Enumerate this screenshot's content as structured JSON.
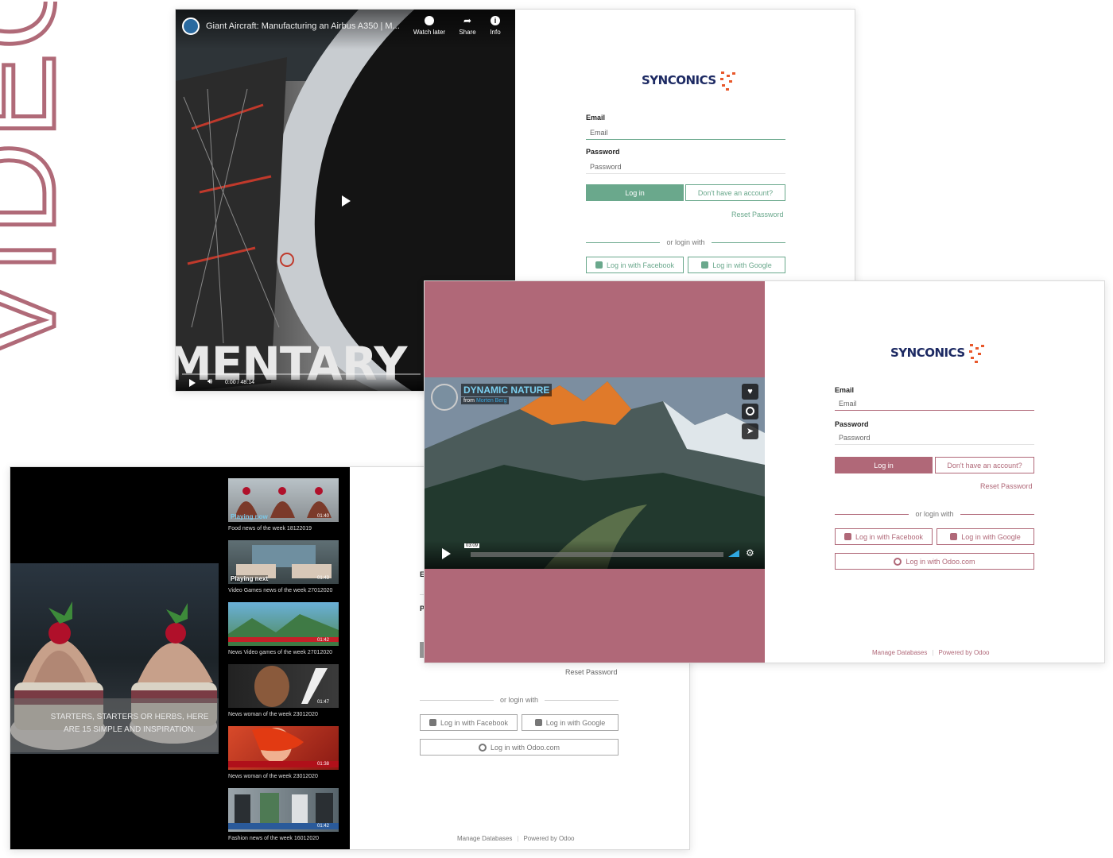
{
  "side_title": "VIDEO",
  "shot1": {
    "video": {
      "title": "Giant Aircraft: Manufacturing an Airbus A350 | M...",
      "actions": [
        "Watch later",
        "Share",
        "Info"
      ],
      "overlay_text": "MENTARY",
      "time": "0:00 / 48:14"
    },
    "login": {
      "brand": "SYNCONICS",
      "email_label": "Email",
      "email_placeholder": "Email",
      "password_label": "Password",
      "password_placeholder": "Password",
      "login_button": "Log in",
      "signup_button": "Don't have an account?",
      "reset_link": "Reset Password",
      "or_text": "or login with",
      "facebook_button": "Log in with Facebook",
      "google_button": "Log in with Google"
    },
    "accent": "#6aa88c"
  },
  "shot2": {
    "video": {
      "title": "DYNAMIC NATURE",
      "from_prefix": "from",
      "author": "Morten Berg",
      "time": "03:09"
    },
    "login": {
      "brand": "SYNCONICS",
      "email_label": "Email",
      "email_placeholder": "Email",
      "password_label": "Password",
      "password_placeholder": "Password",
      "login_button": "Log in",
      "signup_button": "Don't have an account?",
      "reset_link": "Reset Password",
      "or_text": "or login with",
      "facebook_button": "Log in with Facebook",
      "google_button": "Log in with Google",
      "odoo_button": "Log in with Odoo.com",
      "manage_db": "Manage Databases",
      "powered": "Powered by Odoo"
    },
    "accent": "#b06878"
  },
  "shot3": {
    "hero_caption": "STARTERS, STARTERS OR HERBS, HERE ARE 15 SIMPLE AND INSPIRATION.",
    "playlist": [
      {
        "tag": "Playing now",
        "duration": "01:40",
        "caption": "Food news of the week 18122019"
      },
      {
        "tag": "Playing next",
        "duration": "01:43",
        "caption": "Video Games news of the week 27012020"
      },
      {
        "tag": "",
        "duration": "01:42",
        "caption": "News Video games of the week 27012020"
      },
      {
        "tag": "",
        "duration": "01:47",
        "caption": "News woman of the week 23012020"
      },
      {
        "tag": "",
        "duration": "01:38",
        "caption": "News woman of the week 23012020"
      },
      {
        "tag": "",
        "duration": "01:42",
        "caption": "Fashion news of the week 16012020"
      }
    ],
    "login": {
      "label_e": "E",
      "label_p": "P",
      "reset_link": "Reset Password",
      "or_text": "or login with",
      "facebook_button": "Log in with Facebook",
      "google_button": "Log in with Google",
      "odoo_button": "Log in with Odoo.com",
      "manage_db": "Manage Databases",
      "powered": "Powered by Odoo"
    },
    "accent": "#888888"
  }
}
